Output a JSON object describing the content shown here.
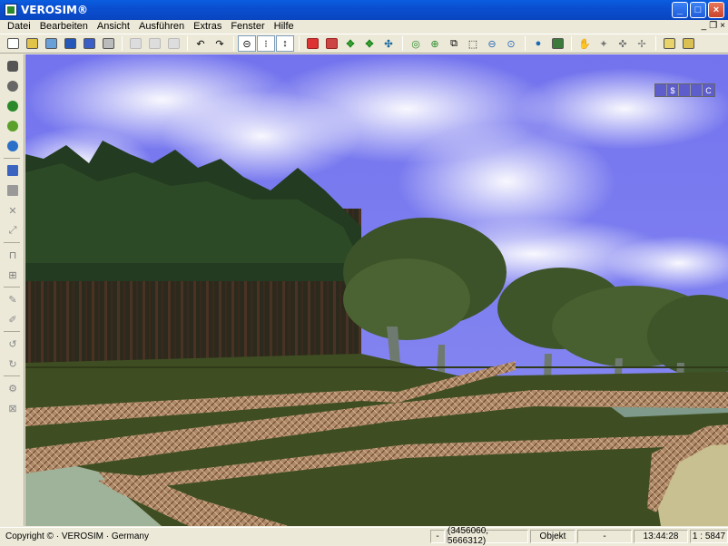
{
  "window": {
    "title": "VEROSIM®"
  },
  "menu": [
    "Datei",
    "Bearbeiten",
    "Ansicht",
    "Ausführen",
    "Extras",
    "Fenster",
    "Hilfe"
  ],
  "toolbar": {
    "icons": [
      "new-icon",
      "open-icon",
      "open-folder-icon",
      "save-icon",
      "save-all-icon",
      "print-icon",
      "cut-icon",
      "copy-icon",
      "paste-icon",
      "undo-icon",
      "redo-icon",
      "link-icon",
      "link-add-icon",
      "link-scale-icon",
      "object-icon",
      "object-remove-icon",
      "move-icon",
      "rotate-icon",
      "scale-icon",
      "center-icon",
      "zoom-in-icon",
      "zoom-box-icon",
      "zoom-fit-icon",
      "zoom-icon",
      "zoom-out-icon",
      "globe-icon",
      "map-icon",
      "hand-icon",
      "camera-icon",
      "arrows-icon",
      "window-icon",
      "layout-icon"
    ]
  },
  "leftbar": {
    "icons": [
      "car-icon",
      "brush-icon",
      "tree-icon",
      "leaf-icon",
      "target-icon",
      "pen-icon",
      "layers-icon",
      "cross-icon",
      "expand-icon",
      "stairs-icon",
      "grid-icon",
      "pencil-icon",
      "eraser-icon",
      "rotate-left-icon",
      "rotate-right-icon",
      "settings-icon",
      "lock-icon"
    ]
  },
  "viewwidget": {
    "labels": [
      "",
      "$",
      "",
      "",
      "C"
    ]
  },
  "colors": {
    "sky": "#6f6ee8",
    "title": "#0a5ee0",
    "grass": "#3e4e22"
  },
  "status": {
    "copyright": "Copyright © · VEROSIM · Germany",
    "dash1": "-",
    "coords": "(3456060, 5666312)",
    "mode": "Objekt",
    "dash2": "-",
    "time": "13:44:28",
    "scale": "1 : 5847"
  }
}
